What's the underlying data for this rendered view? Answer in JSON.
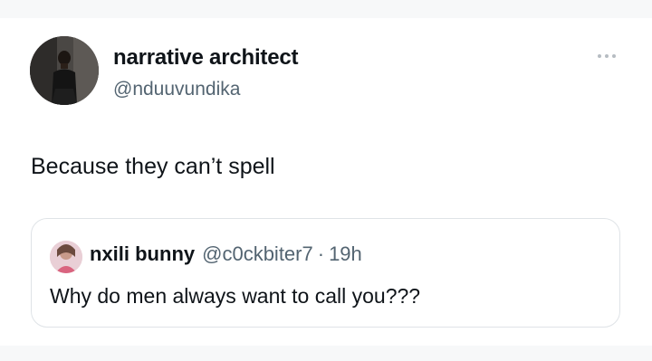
{
  "author": {
    "display_name": "narrative architect",
    "handle": "@nduuvundika"
  },
  "tweet": {
    "text": "Because they can’t spell"
  },
  "more_icon": "more-horizontal-icon",
  "quoted_tweet": {
    "display_name": "nxili bunny",
    "handle": "@c0ckbiter7",
    "separator": "·",
    "time": "19h",
    "text": "Why do men always want to call you???"
  },
  "colors": {
    "text_primary": "#0f1419",
    "text_secondary": "#536471",
    "border": "#dfe3e7",
    "background": "#ffffff"
  }
}
